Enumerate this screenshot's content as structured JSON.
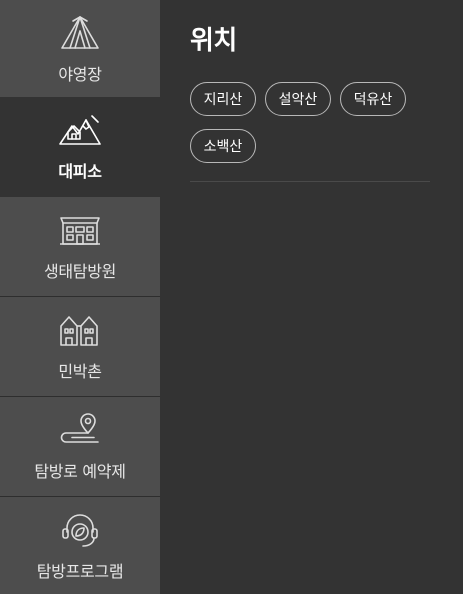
{
  "sidebar": {
    "items": [
      {
        "label": "야영장",
        "icon": "tent-icon",
        "active": false
      },
      {
        "label": "대피소",
        "icon": "mountain-shelter-icon",
        "active": true
      },
      {
        "label": "생태탐방원",
        "icon": "building-icon",
        "active": false
      },
      {
        "label": "민박촌",
        "icon": "houses-icon",
        "active": false
      },
      {
        "label": "탐방로 예약제",
        "icon": "trail-pin-icon",
        "active": false
      },
      {
        "label": "탐방프로그램",
        "icon": "headset-leaf-icon",
        "active": false
      }
    ]
  },
  "main": {
    "title": "위치",
    "locations": [
      "지리산",
      "설악산",
      "덕유산",
      "소백산"
    ]
  },
  "colors": {
    "sidebar_bg": "#4d4d4d",
    "active_bg": "#333333",
    "chip_border": "#b8b8b8",
    "text": "#ffffff"
  }
}
